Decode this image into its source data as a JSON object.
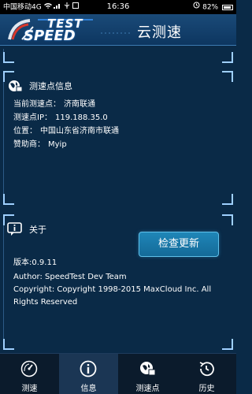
{
  "status_bar": {
    "carrier": "中国移动4G",
    "time": "16:36",
    "battery": "82%"
  },
  "header": {
    "logo_top": "TEST",
    "logo_bottom": "SPEED",
    "title": "云测速"
  },
  "server_info": {
    "heading": "测速点信息",
    "rows": [
      {
        "key": "当前测速点：",
        "value": "济南联通"
      },
      {
        "key": "测速点IP：",
        "value": "119.188.35.0"
      },
      {
        "key": "位置：",
        "value": "中国山东省济南市联通"
      },
      {
        "key": "赞助商：",
        "value": "Myip"
      }
    ]
  },
  "about": {
    "heading": "关于",
    "check_update_label": "检查更新",
    "version": "版本:0.9.11",
    "author": "Author:  SpeedTest Dev Team",
    "copyright": "Copyright:  Copyright 1998-2015 MaxCloud Inc. All Rights Reserved"
  },
  "tabs": [
    {
      "label": "测速",
      "icon": "speedometer-icon",
      "active": false
    },
    {
      "label": "信息",
      "icon": "info-icon",
      "active": true
    },
    {
      "label": "测速点",
      "icon": "globe-icon",
      "active": false
    },
    {
      "label": "历史",
      "icon": "history-icon",
      "active": false
    }
  ],
  "colors": {
    "background": "#0a2a47",
    "accent": "#1f86b8",
    "tab_active": "#1b3654"
  }
}
